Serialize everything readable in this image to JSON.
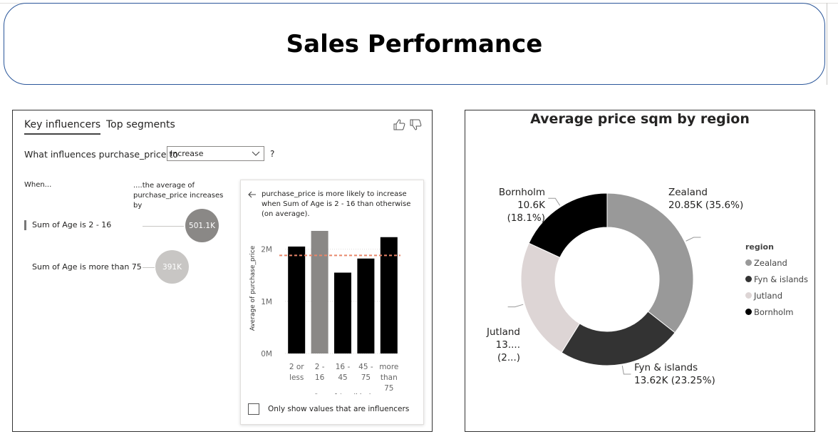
{
  "page": {
    "title": "Sales Performance"
  },
  "key_influencers": {
    "tabs": [
      {
        "label": "Key influencers",
        "active": true
      },
      {
        "label": "Top segments",
        "active": false
      }
    ],
    "question_prefix": "What influences purchase_price to",
    "dropdown_value": "Increase",
    "question_suffix": "?",
    "col_when": "When...",
    "col_avg": "....the average of purchase_price increases by",
    "influencers": [
      {
        "label": "Sum of Age is 2 - 16",
        "value": "501.1K",
        "color": "#8a8886"
      },
      {
        "label": "Sum of Age is more than 75",
        "value": "391K",
        "color": "#c8c6c4"
      }
    ],
    "detail_text": "purchase_price is more likely to increase when Sum of Age is 2 - 16 than otherwise (on average).",
    "checkbox_label": "Only show values that are influencers"
  },
  "chart_data": [
    {
      "type": "bar",
      "ylabel": "Average of purchase_price",
      "xlabel": "Sum of Age (bins)",
      "categories": [
        [
          "2 or",
          "less"
        ],
        [
          "2 -",
          "16"
        ],
        [
          "16 -",
          "45"
        ],
        [
          "45 -",
          "75"
        ],
        [
          "more",
          "than",
          "75"
        ]
      ],
      "values": [
        2050000,
        2350000,
        1550000,
        1820000,
        2230000
      ],
      "colors": [
        "#000000",
        "#8a8886",
        "#000000",
        "#000000",
        "#000000"
      ],
      "yticks": [
        {
          "v": 0,
          "label": "0M"
        },
        {
          "v": 1000000,
          "label": "1M"
        },
        {
          "v": 2000000,
          "label": "2M"
        }
      ],
      "ylim": [
        0,
        2500000
      ],
      "reference_line": 1880000,
      "reference_color": "#e8866a"
    },
    {
      "type": "pie",
      "title": "Average price sqm by region",
      "legend_title": "region",
      "legend_position": "right",
      "slices": [
        {
          "name": "Zealand",
          "value": 20850,
          "line1": "Zealand",
          "line2": "20.85K (35.6%)",
          "color": "#999999"
        },
        {
          "name": "Fyn & islands",
          "value": 13620,
          "line1": "Fyn & islands",
          "line2": "13.62K (23.25%)",
          "color": "#333333"
        },
        {
          "name": "Jutland",
          "value": 13490,
          "line1": "Jutland",
          "line2": "13.... (2...)",
          "color": "#ddd5d5"
        },
        {
          "name": "Bornholm",
          "value": 10600,
          "line1": "Bornholm",
          "line2": "10.6K (18.1%)",
          "color": "#000000"
        }
      ]
    }
  ]
}
